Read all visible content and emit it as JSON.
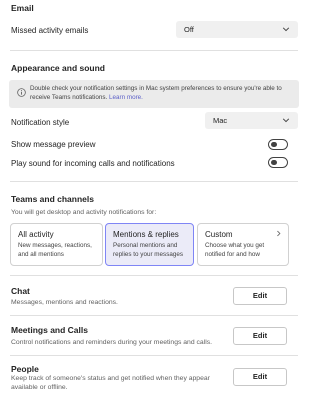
{
  "email": {
    "heading": "Email",
    "missed_label": "Missed activity emails",
    "missed_value": "Off"
  },
  "appearance": {
    "heading": "Appearance and sound",
    "info_text": "Double check your notification settings in Mac system preferences to ensure you're able to receive Teams notifications.",
    "learn_more": "Learn more.",
    "style_label": "Notification style",
    "style_value": "Mac",
    "preview_label": "Show message preview",
    "preview_on": false,
    "sound_label": "Play sound for incoming calls and notifications",
    "sound_on": false
  },
  "teams": {
    "heading": "Teams and channels",
    "desc": "You will get desktop and activity notifications for:",
    "options": [
      {
        "title": "All activity",
        "desc": "New messages, reactions, and all mentions",
        "selected": false
      },
      {
        "title": "Mentions & replies",
        "desc": "Personal mentions and replies to your messages",
        "selected": true
      },
      {
        "title": "Custom",
        "desc": "Choose what you get notified for and how",
        "selected": false
      }
    ]
  },
  "chat": {
    "heading": "Chat",
    "desc": "Messages, mentions and reactions.",
    "edit": "Edit"
  },
  "meetings": {
    "heading": "Meetings and Calls",
    "desc": "Control notifications and reminders during your meetings and calls.",
    "edit": "Edit"
  },
  "people": {
    "heading": "People",
    "desc": "Keep track of someone's status and get notified when they appear available or offline.",
    "edit": "Edit"
  },
  "colors": {
    "accent": "#5b5fc7",
    "selected_card_bg": "#ebebf8",
    "selected_card_border": "#7f85f5"
  }
}
